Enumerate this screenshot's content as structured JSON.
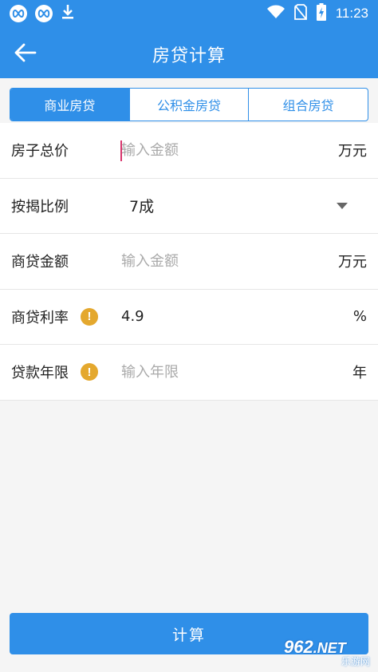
{
  "status_bar": {
    "time": "11:23"
  },
  "header": {
    "title": "房贷计算"
  },
  "tabs": [
    {
      "label": "商业房贷",
      "active": true
    },
    {
      "label": "公积金房贷",
      "active": false
    },
    {
      "label": "组合房贷",
      "active": false
    }
  ],
  "form": {
    "house_price": {
      "label": "房子总价",
      "placeholder": "输入金额",
      "value": "",
      "unit": "万元"
    },
    "down_payment": {
      "label": "按揭比例",
      "value": "7成"
    },
    "loan_amount": {
      "label": "商贷金额",
      "placeholder": "输入金额",
      "value": "",
      "unit": "万元"
    },
    "loan_rate": {
      "label": "商贷利率",
      "value": "4.9",
      "unit": "%"
    },
    "loan_term": {
      "label": "贷款年限",
      "placeholder": "输入年限",
      "value": "",
      "unit": "年"
    }
  },
  "actions": {
    "calculate_label": "计算"
  },
  "watermark": {
    "brand": "962",
    "suffix": ".NET",
    "sub": "乐游网"
  },
  "colors": {
    "primary": "#2f8fe8",
    "warning": "#e4a82e",
    "cursor": "#d8336b"
  }
}
